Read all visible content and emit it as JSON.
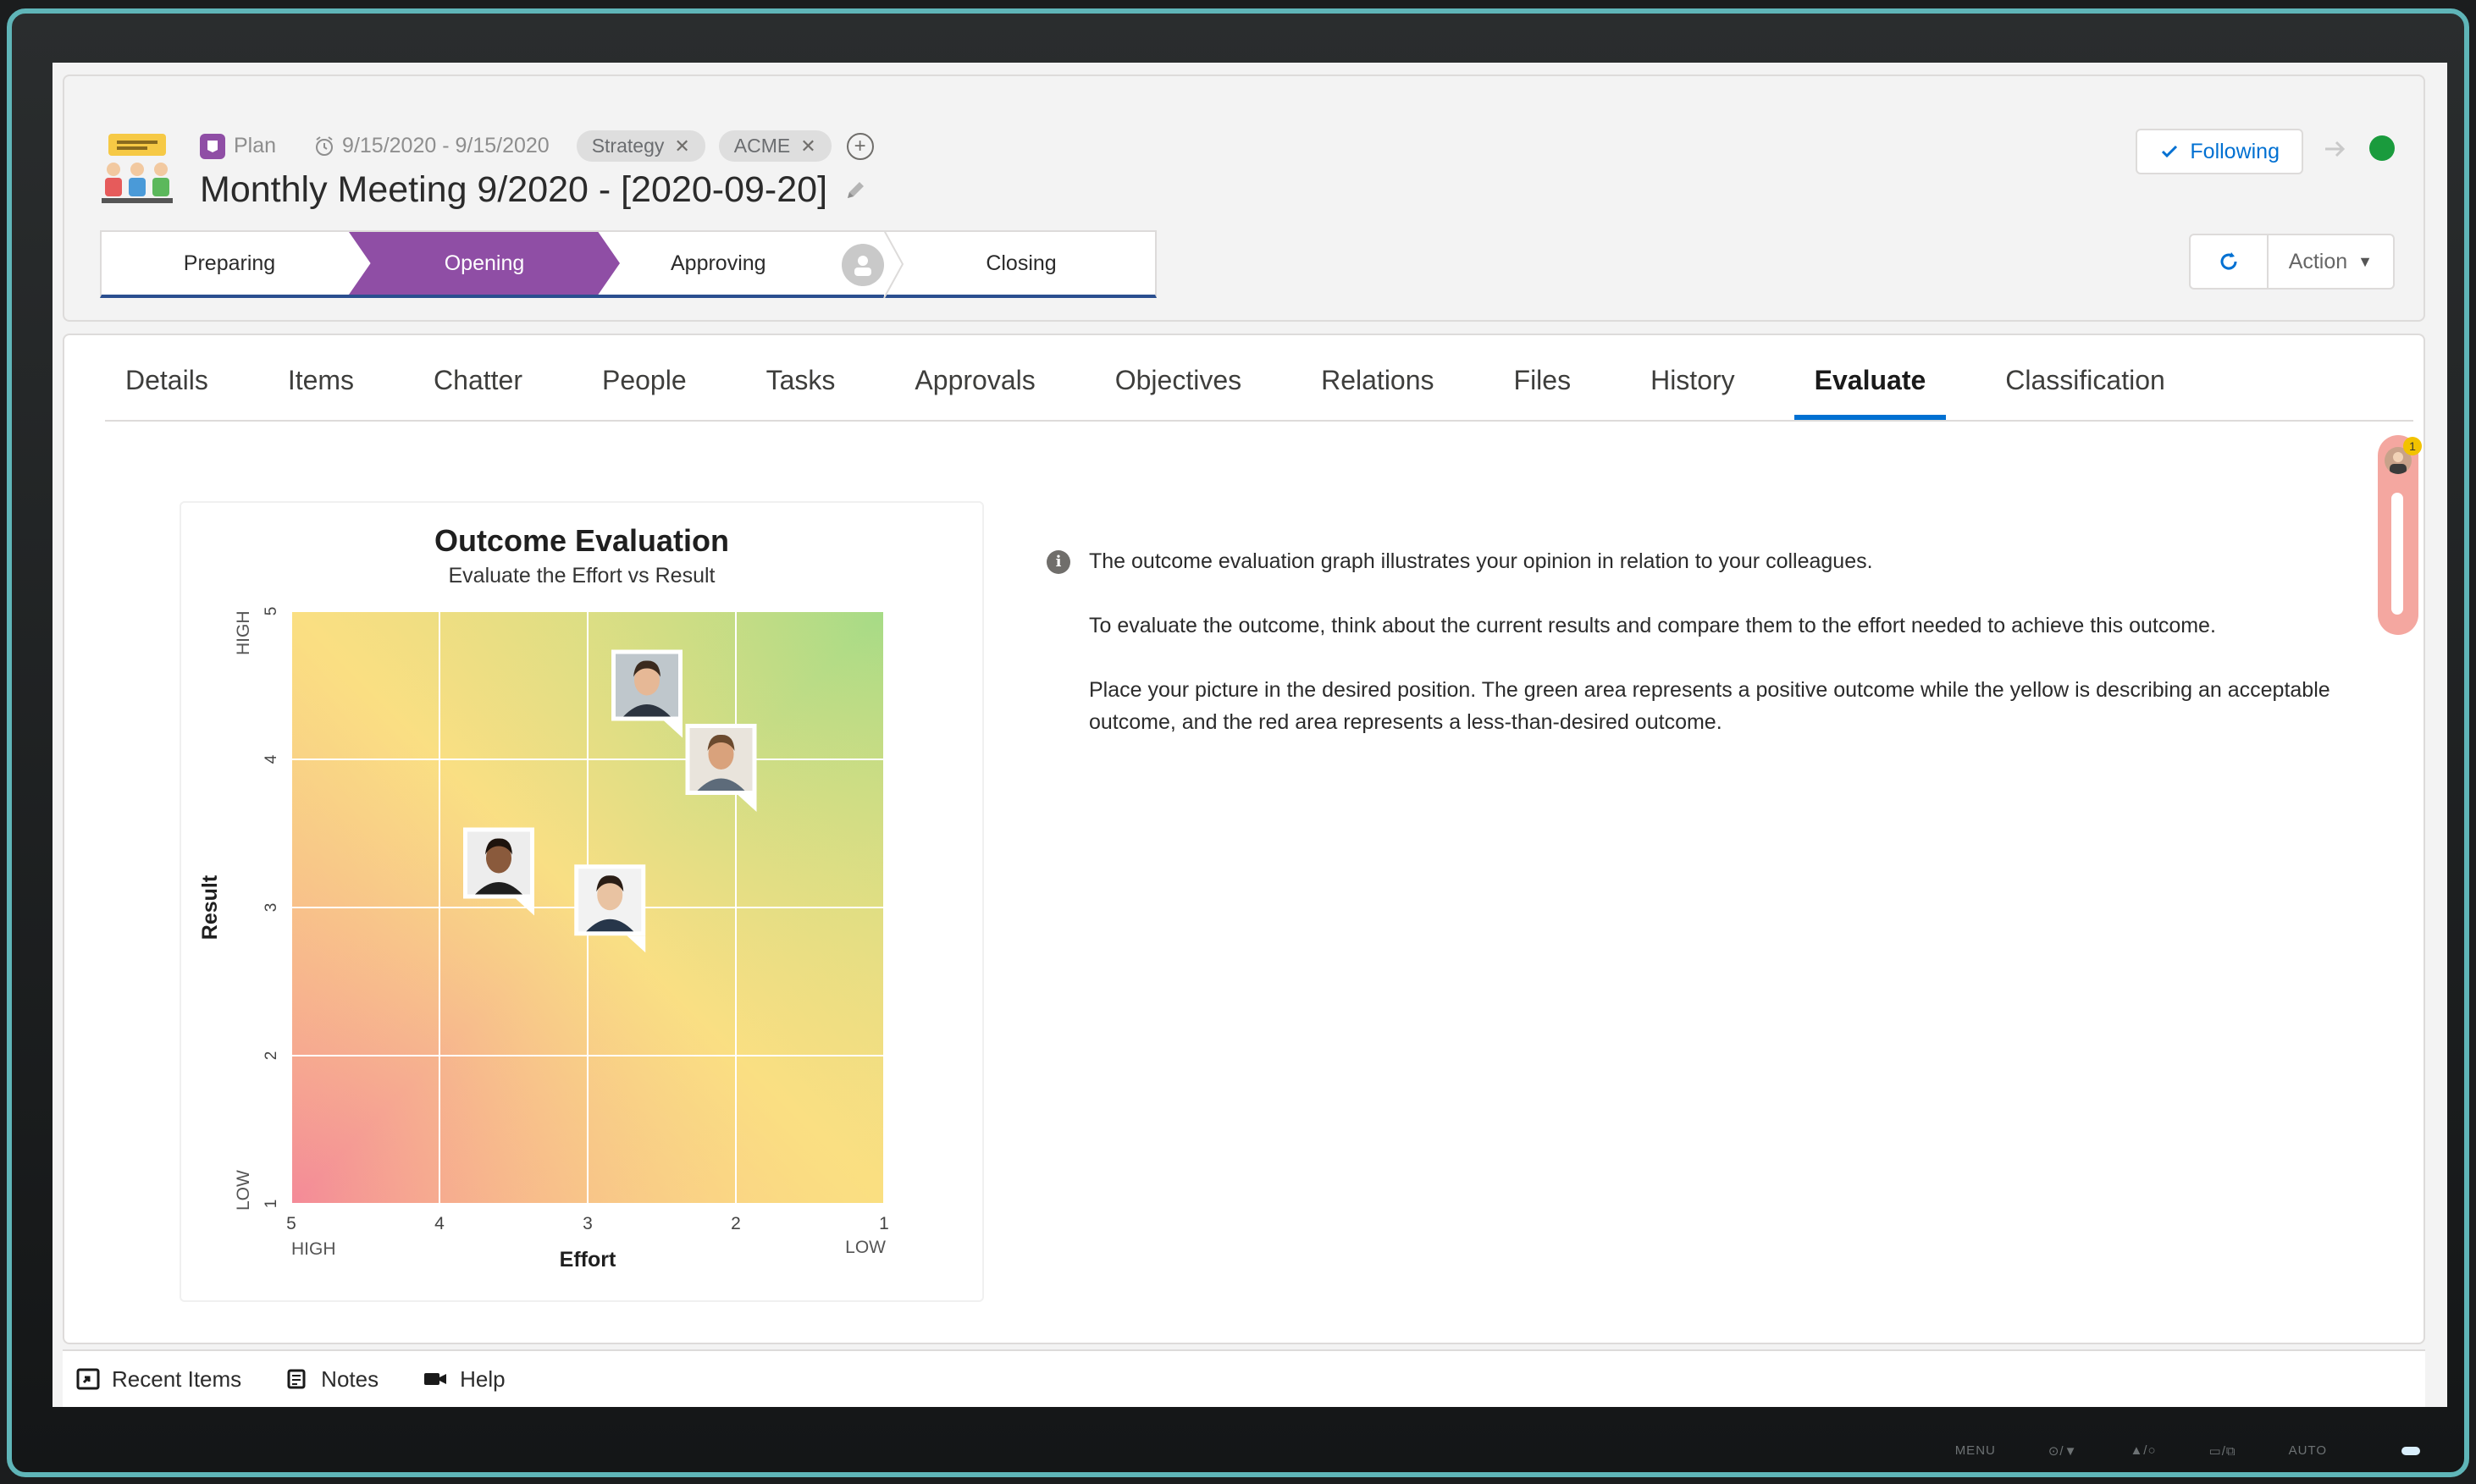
{
  "header": {
    "object_type": "Plan",
    "date_range": "9/15/2020 - 9/15/2020",
    "tags": [
      "Strategy",
      "ACME"
    ],
    "title": "Monthly Meeting 9/2020 - [2020-09-20]",
    "follow_label": "Following",
    "action_label": "Action",
    "status_color": "#1a9b3d"
  },
  "path": {
    "steps": [
      "Preparing",
      "Opening",
      "Approving",
      "Closing"
    ],
    "current": "Opening",
    "accent": "#8f4ea5"
  },
  "tabs": {
    "items": [
      "Details",
      "Items",
      "Chatter",
      "People",
      "Tasks",
      "Approvals",
      "Objectives",
      "Relations",
      "Files",
      "History",
      "Evaluate",
      "Classification"
    ],
    "active": "Evaluate"
  },
  "scroll_widget": {
    "count": "1"
  },
  "chart_data": {
    "type": "scatter",
    "title": "Outcome Evaluation",
    "subtitle": "Evaluate the Effort vs Result",
    "xlabel": "Effort",
    "ylabel": "Result",
    "x_ticks": [
      "5",
      "4",
      "3",
      "2",
      "1"
    ],
    "y_ticks": [
      "1",
      "2",
      "3",
      "4",
      "5"
    ],
    "xlim": [
      5,
      1
    ],
    "ylim": [
      1,
      5
    ],
    "x_end_labels": {
      "low_value_side": "HIGH",
      "high_value_side": "LOW"
    },
    "y_end_labels": {
      "top": "HIGH",
      "bottom": "LOW"
    },
    "grid": true,
    "points": [
      {
        "x": 2.6,
        "y": 4.5,
        "marker": "avatar-man-suit"
      },
      {
        "x": 2.1,
        "y": 4.0,
        "marker": "avatar-man-beard"
      },
      {
        "x": 3.6,
        "y": 3.3,
        "marker": "avatar-woman"
      },
      {
        "x": 2.85,
        "y": 3.05,
        "marker": "avatar-woman-2"
      }
    ]
  },
  "description": {
    "paragraphs": [
      "The outcome evaluation graph illustrates your opinion in relation to your colleagues.",
      "To evaluate the outcome, think about the current results and compare them to the effort needed to achieve this outcome.",
      "Place your picture in the desired position. The green area represents a positive outcome while the yellow is describing an acceptable outcome, and the red area represents a less-than-desired outcome."
    ]
  },
  "utility_bar": {
    "items": [
      "Recent Items",
      "Notes",
      "Help"
    ]
  },
  "bezel_controls": [
    "MENU",
    "⊙/▼",
    "▲/○",
    "▭/⧉",
    "AUTO"
  ]
}
